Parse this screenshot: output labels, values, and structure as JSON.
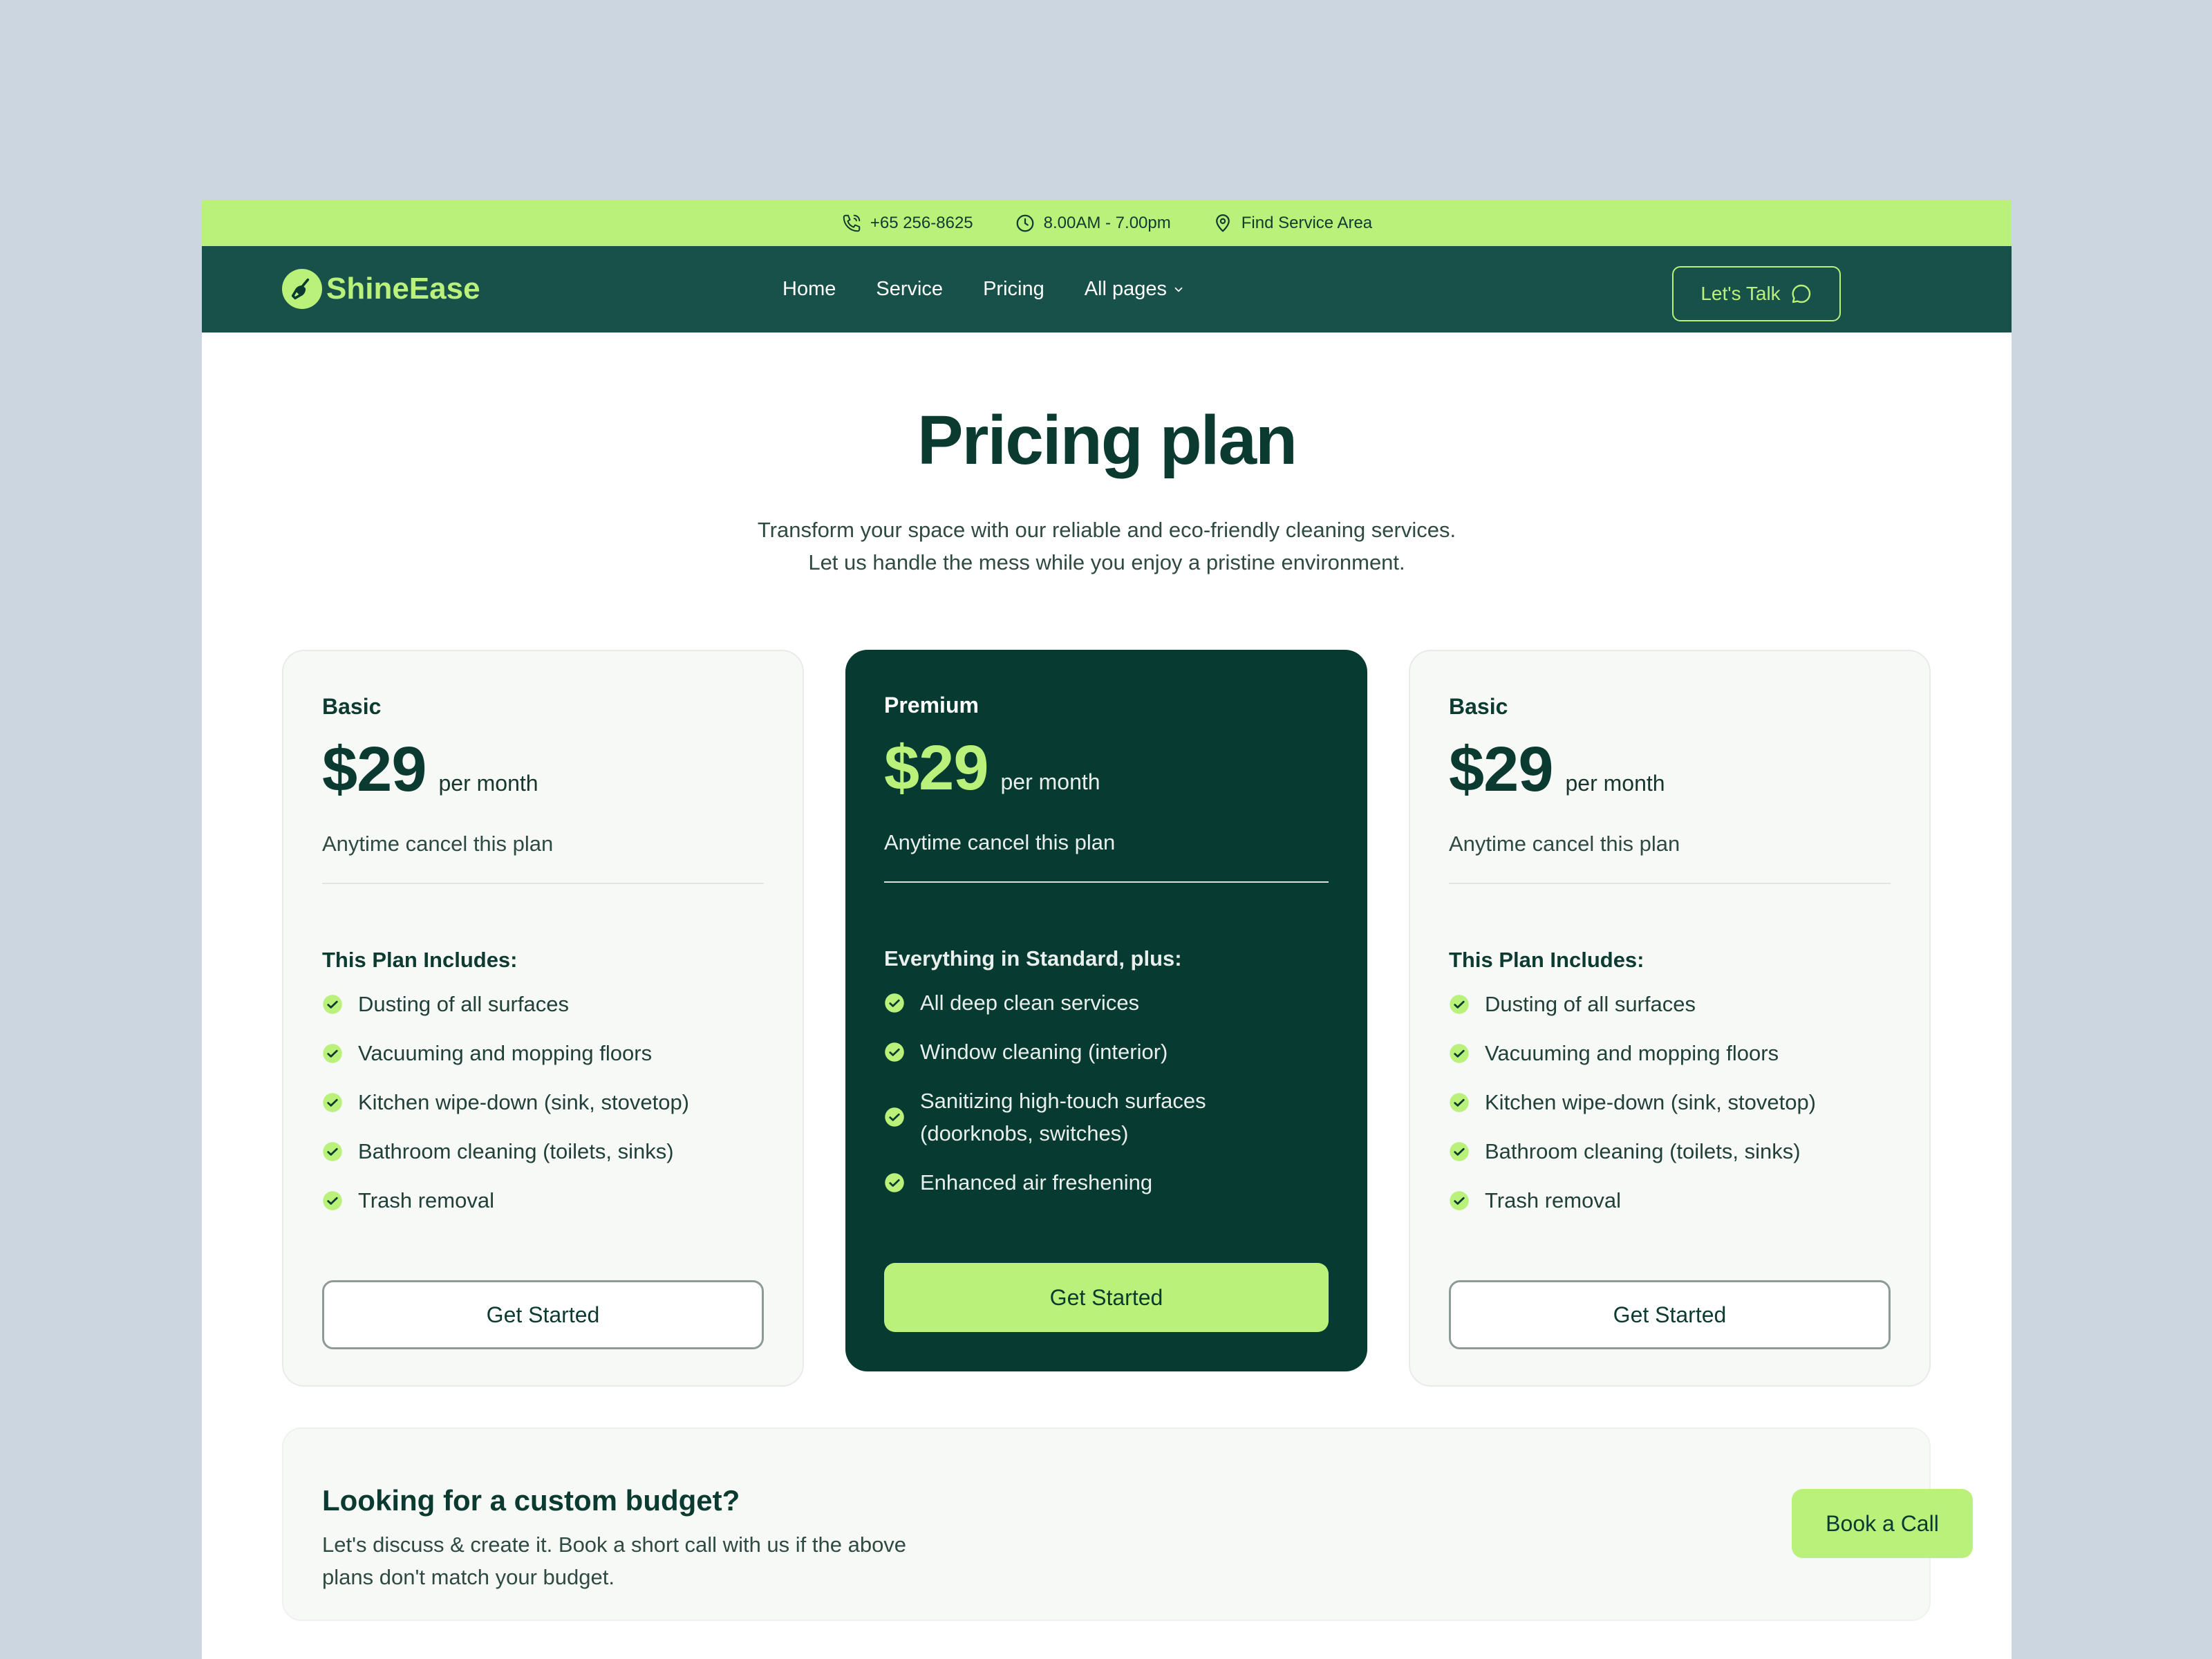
{
  "topbar": {
    "phone": "+65 256-8625",
    "hours": "8.00AM - 7.00pm",
    "service_area": "Find Service Area"
  },
  "nav": {
    "brand": "ShineEase",
    "links": [
      {
        "label": "Home"
      },
      {
        "label": "Service"
      },
      {
        "label": "Pricing"
      },
      {
        "label": "All pages"
      }
    ],
    "cta": "Let's Talk"
  },
  "hero": {
    "title": "Pricing plan",
    "subtitle_line1": "Transform your space with our reliable and eco-friendly cleaning services.",
    "subtitle_line2": "Let us handle the mess while you enjoy a pristine environment."
  },
  "plans": [
    {
      "name": "Basic",
      "price": "$29",
      "period": "per month",
      "note": "Anytime cancel this plan",
      "includes_title": "This Plan Includes:",
      "features": [
        "Dusting of all surfaces",
        "Vacuuming and mopping floors",
        "Kitchen wipe-down (sink, stovetop)",
        "Bathroom cleaning (toilets, sinks)",
        "Trash removal"
      ],
      "cta": "Get Started"
    },
    {
      "name": "Premium",
      "price": "$29",
      "period": "per month",
      "note": "Anytime cancel this plan",
      "includes_title": "Everything in Standard, plus:",
      "features": [
        "All deep clean services",
        "Window cleaning (interior)",
        "Sanitizing high-touch surfaces (doorknobs, switches)",
        "Enhanced air freshening"
      ],
      "cta": "Get Started"
    },
    {
      "name": "Basic",
      "price": "$29",
      "period": "per month",
      "note": "Anytime cancel this plan",
      "includes_title": "This Plan Includes:",
      "features": [
        "Dusting of all surfaces",
        "Vacuuming and mopping floors",
        "Kitchen wipe-down (sink, stovetop)",
        "Bathroom cleaning (toilets, sinks)",
        "Trash removal"
      ],
      "cta": "Get Started"
    }
  ],
  "budget": {
    "title": "Looking for a custom budget?",
    "text": "Let's discuss & create it. Book a short call with us if the above plans don't match your budget.",
    "cta": "Book a Call"
  },
  "colors": {
    "accent": "#b9f17b",
    "nav_bg": "#18514a",
    "dark_card": "#073a30",
    "heading": "#0a3a30"
  }
}
